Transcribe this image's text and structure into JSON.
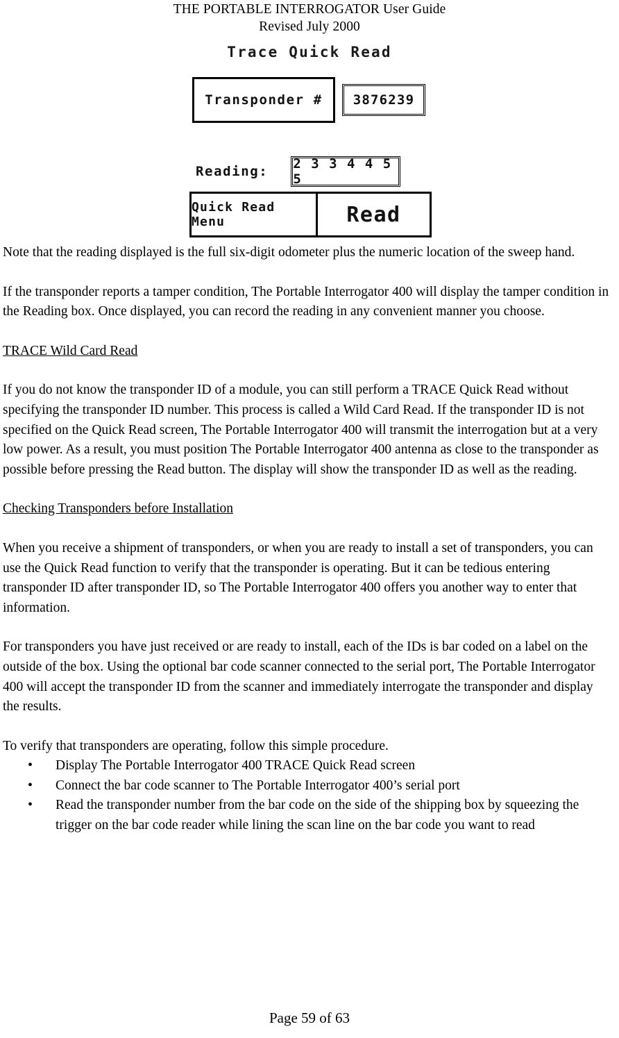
{
  "header": {
    "title": "THE PORTABLE INTERROGATOR User Guide",
    "revision": "Revised July 2000"
  },
  "lcd_screenshot": {
    "screen_title": "Trace Quick Read",
    "transponder_label": "Transponder #",
    "transponder_id": "3876239",
    "reading_label": "Reading:",
    "reading_value": "2 3 3 4 4 5 5",
    "quick_read_menu_button": "Quick Read Menu",
    "read_button": "Read"
  },
  "body": {
    "p1": "Note that the reading displayed is the full six-digit odometer plus the numeric location of the sweep hand.",
    "p2": "If the transponder reports a tamper condition, The Portable Interrogator 400 will display the tamper condition in the Reading box.  Once displayed, you can record the reading in any convenient manner you choose.",
    "heading1": "TRACE Wild Card Read",
    "p3": "If you do not know the transponder ID of a module, you can still perform a TRACE Quick Read without specifying the transponder ID number.  This process is called a Wild Card Read.  If the transponder ID is not specified on the Quick Read screen, The Portable Interrogator 400 will transmit the interrogation but at a very low power.  As a result, you must position The Portable Interrogator 400 antenna as close to the transponder as possible before pressing the Read button.  The display will show the transponder ID as well as the reading.",
    "heading2": "Checking Transponders before Installation",
    "p4": "When you receive a shipment of transponders, or when you are ready to install a set of transponders, you can use the Quick Read function to verify that the transponder is operating.  But it can be tedious entering transponder ID after transponder ID, so The Portable Interrogator 400 offers you another way to enter that information.",
    "p5": "For transponders you have just received or are ready to install, each of the IDs is bar coded on a label on the outside of the box.  Using the optional bar code scanner connected to the serial port, The Portable Interrogator 400 will accept the transponder ID from the scanner and immediately interrogate the transponder and display the results.",
    "p6": "To verify that transponders are operating, follow this simple procedure.",
    "bullet_glyph": "•",
    "procedure": [
      "Display The Portable Interrogator 400 TRACE Quick Read screen",
      "Connect the bar code scanner to The Portable Interrogator 400’s serial port",
      "Read the transponder number from the bar code on the side of the shipping box by squeezing the trigger on the bar code reader while lining the scan line on the bar code you want to read"
    ]
  },
  "footer": {
    "page_label": "Page 59 of 63"
  }
}
